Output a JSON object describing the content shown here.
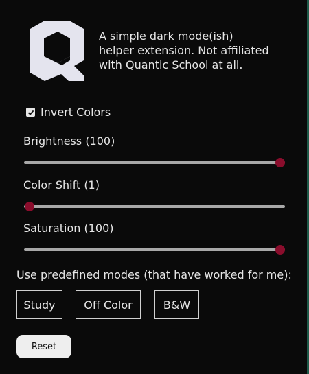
{
  "description": "A simple dark mode(ish) helper extension. Not affiliated with Quantic School at all.",
  "invert": {
    "label": "Invert Colors",
    "checked": true
  },
  "sliders": {
    "brightness": {
      "label": "Brightness (100)",
      "value": 100,
      "min": 0,
      "max": 100
    },
    "color_shift": {
      "label": "Color Shift (1)",
      "value": 1,
      "min": 1,
      "max": 360
    },
    "saturation": {
      "label": "Saturation (100)",
      "value": 100,
      "min": 0,
      "max": 100
    }
  },
  "modes": {
    "label": "Use predefined modes (that have worked for me):",
    "buttons": [
      "Study",
      "Off Color",
      "B&W"
    ]
  },
  "reset_label": "Reset",
  "colors": {
    "background": "#0a0a0a",
    "text": "#e6e6e6",
    "slider_thumb": "#8a0d2c",
    "slider_track": "#a8a8a8",
    "logo": "#e4e4ee"
  },
  "icons": {
    "logo": "quantic-q-logo-icon",
    "checkbox": "checkmark-icon"
  }
}
